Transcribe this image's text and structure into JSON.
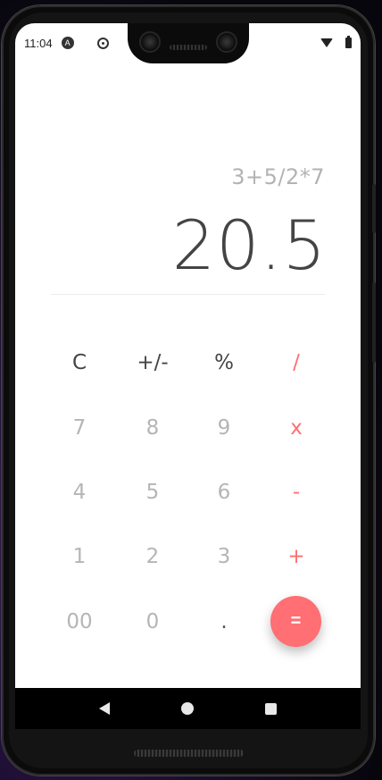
{
  "status_bar": {
    "time": "11:04",
    "app_badge": "A"
  },
  "display": {
    "expression": "3+5/2*7",
    "result": "20.5"
  },
  "keypad": {
    "clear": "C",
    "sign": "+/-",
    "percent": "%",
    "divide": "/",
    "seven": "7",
    "eight": "8",
    "nine": "9",
    "multiply": "x",
    "four": "4",
    "five": "5",
    "six": "6",
    "minus": "-",
    "one": "1",
    "two": "2",
    "three": "3",
    "plus": "+",
    "double_zero": "00",
    "zero": "0",
    "decimal": ".",
    "equals": "="
  },
  "colors": {
    "accent": "#ff6f73",
    "operator": "#ff6f6f",
    "number": "#b5b5b5",
    "function": "#444444"
  },
  "icons": {
    "status": [
      "app-badge-icon",
      "sync-icon",
      "wifi-icon",
      "battery-icon"
    ],
    "nav": [
      "back-icon",
      "home-icon",
      "recents-icon"
    ]
  }
}
